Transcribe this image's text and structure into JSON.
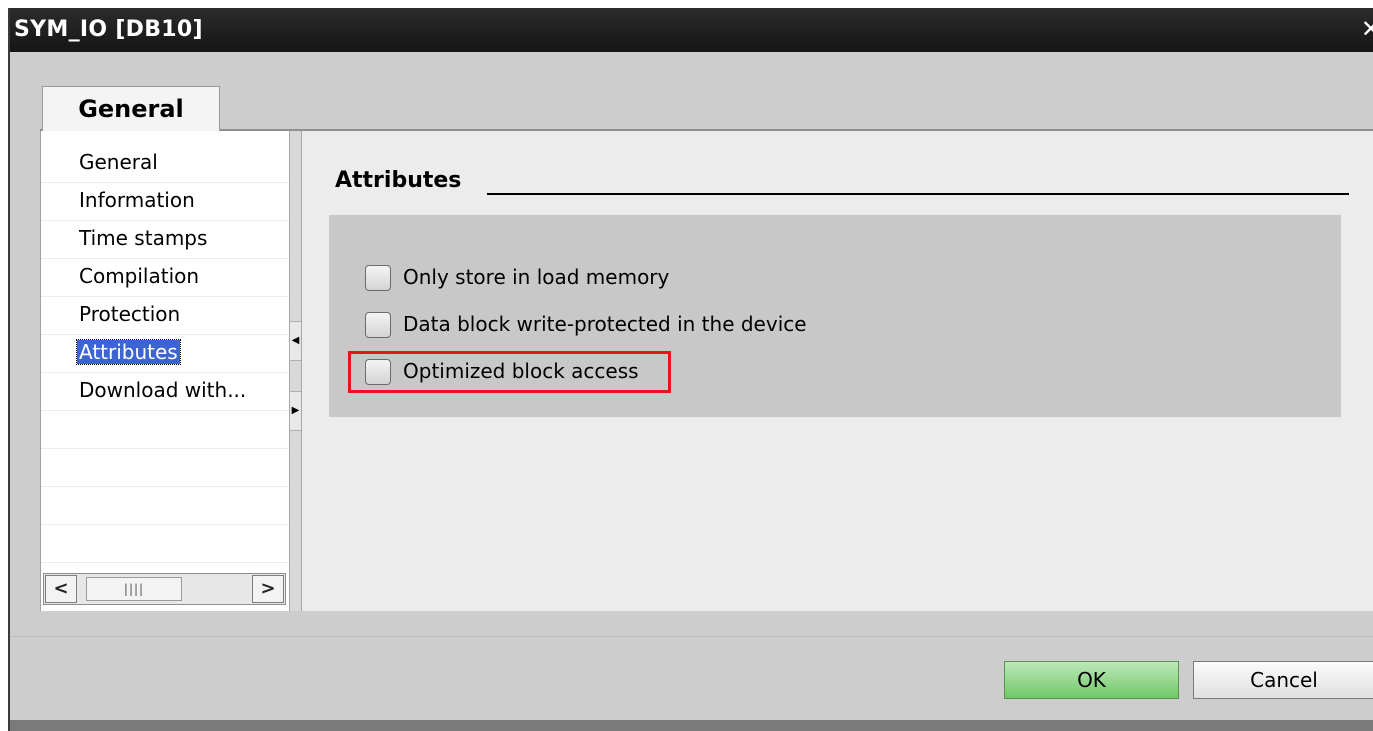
{
  "window": {
    "title": "SYM_IO [DB10]",
    "close_glyph": "✕"
  },
  "tabs": [
    {
      "label": "General"
    }
  ],
  "nav": {
    "items": [
      {
        "label": "General"
      },
      {
        "label": "Information"
      },
      {
        "label": "Time stamps"
      },
      {
        "label": "Compilation"
      },
      {
        "label": "Protection"
      },
      {
        "label": "Attributes",
        "selected": true
      },
      {
        "label": "Download with..."
      }
    ],
    "scroll_left": "<",
    "scroll_thumb": "||||",
    "scroll_right": ">"
  },
  "section": {
    "title": "Attributes",
    "checkboxes": [
      {
        "label": "Only store in load memory",
        "checked": false
      },
      {
        "label": "Data block write-protected in the device",
        "checked": false
      },
      {
        "label": "Optimized block access",
        "checked": false,
        "highlighted": true
      }
    ]
  },
  "buttons": {
    "ok": "OK",
    "cancel": "Cancel"
  },
  "colors": {
    "titlebar": "#1e1e1e",
    "selection": "#3c64d2",
    "highlight_border": "#e8161a",
    "ok_button": "#8fd688"
  }
}
